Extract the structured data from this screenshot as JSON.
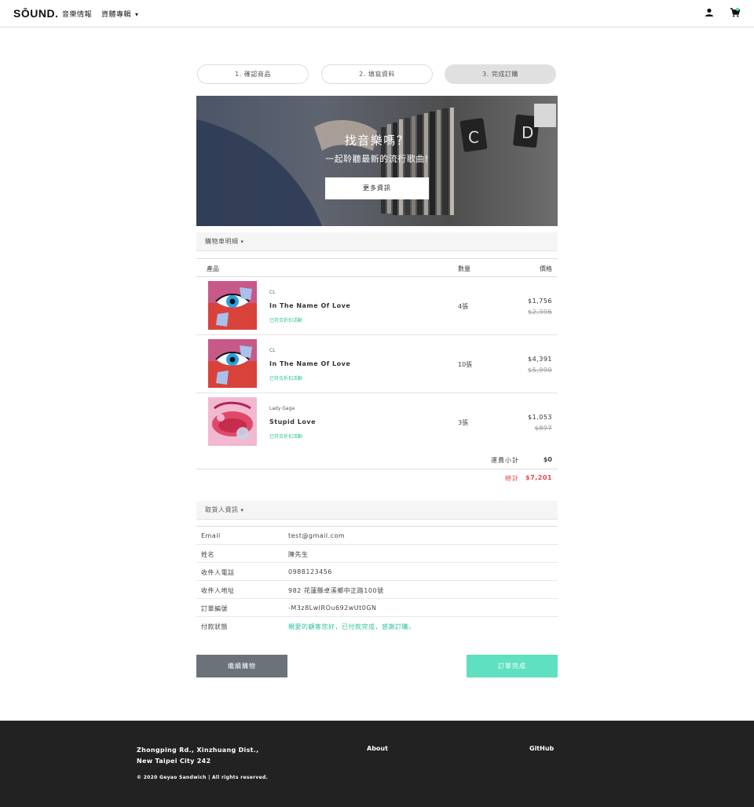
{
  "nav": {
    "logo": "SŌUND.",
    "music_info": "音樂情報",
    "news": "資體專輯",
    "news_caret": "▾",
    "icons": [
      "user-icon",
      "cart-icon"
    ],
    "cart_dot_color": "#4cd8b1"
  },
  "steps": [
    "1. 確認商品",
    "2. 填寫資料",
    "3. 完成訂購"
  ],
  "banner": {
    "title": "找音樂嗎？",
    "subtitle": "一起聆聽最新的流行歌曲!",
    "button": "更多資訊"
  },
  "cart": {
    "header": "購物車明細",
    "header_caret": "▾",
    "columns": {
      "product": "產品",
      "qty": "數量",
      "price": "價格"
    },
    "items": [
      {
        "artist": "CL",
        "title": "In The Name Of Love",
        "promo": "已符合折扣活動",
        "qty": "4張",
        "price": "$1,756",
        "original": "$2,396"
      },
      {
        "artist": "CL",
        "title": "In The Name Of Love",
        "promo": "已符合折扣活動",
        "qty": "10張",
        "price": "$4,391",
        "original": "$5,990"
      },
      {
        "artist": "Lady Gaga",
        "title": "Stupid Love",
        "promo": "已符合折扣活動",
        "qty": "3張",
        "price": "$1,053",
        "original": "$897"
      }
    ],
    "shipping_label": "運費小計",
    "shipping_value": "$0",
    "total_label": "總計",
    "total_value": "$7,201",
    "total_color": "#e6454a",
    "promo_color": "#2dc29a"
  },
  "receiver": {
    "header": "取貨人資訊",
    "header_caret": "▾",
    "rows": [
      {
        "key": "Email",
        "value": "test@gmail.com"
      },
      {
        "key": "姓名",
        "value": "陳先生"
      },
      {
        "key": "收件人電話",
        "value": "0988123456"
      },
      {
        "key": "收件人地址",
        "value": "982 花蓮縣卓溪鄉中正路100號"
      },
      {
        "key": "訂單編號",
        "value": "-M3z8LwIROu692wUt0GN"
      },
      {
        "key": "付款狀態",
        "value": "親愛的顧客您好，已付款完成，感謝訂購。"
      }
    ]
  },
  "actions": {
    "continue": "繼續購物",
    "continue_color": "#6c727a",
    "done": "訂單完成",
    "done_color": "#5fe0c0"
  },
  "footer": {
    "address_line1": "Zhongping Rd., Xinzhuang Dist.,",
    "address_line2": "New Taipei City 242",
    "copyright": "© 2020 Geyao Sandwich | All rights reserved.",
    "about": "About",
    "github": "GitHub"
  }
}
